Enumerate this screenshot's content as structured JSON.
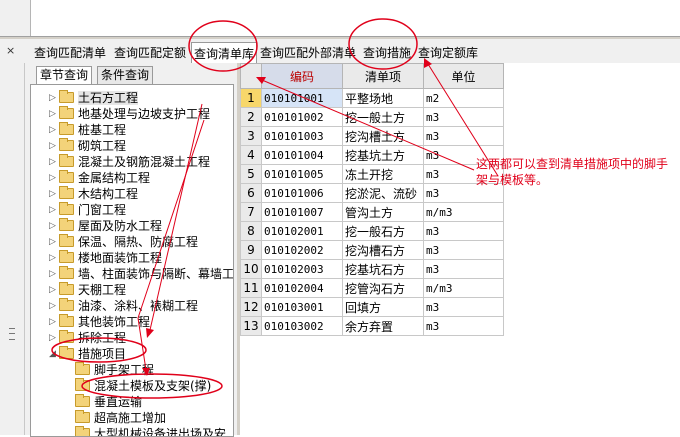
{
  "tabs": [
    {
      "label": "查询匹配清单",
      "active": false
    },
    {
      "label": "查询匹配定额",
      "active": false
    },
    {
      "label": "查询清单库",
      "active": true
    },
    {
      "label": "查询匹配外部清单",
      "active": false
    },
    {
      "label": "查询措施",
      "active": false
    },
    {
      "label": "查询定额库",
      "active": false
    }
  ],
  "close_button": "×",
  "subtabs": {
    "chapter": "章节查询",
    "condition": "条件查询"
  },
  "tree": [
    {
      "label": "土石方工程",
      "expander": "▷"
    },
    {
      "label": "地基处理与边坡支护工程",
      "expander": "▷"
    },
    {
      "label": "桩基工程",
      "expander": "▷"
    },
    {
      "label": "砌筑工程",
      "expander": "▷"
    },
    {
      "label": "混凝土及钢筋混凝土工程",
      "expander": "▷"
    },
    {
      "label": "金属结构工程",
      "expander": "▷"
    },
    {
      "label": "木结构工程",
      "expander": "▷"
    },
    {
      "label": "门窗工程",
      "expander": "▷"
    },
    {
      "label": "屋面及防水工程",
      "expander": "▷"
    },
    {
      "label": "保温、隔热、防腐工程",
      "expander": "▷"
    },
    {
      "label": "楼地面装饰工程",
      "expander": "▷"
    },
    {
      "label": "墙、柱面装饰与隔断、幕墙工",
      "expander": "▷"
    },
    {
      "label": "天棚工程",
      "expander": "▷"
    },
    {
      "label": "油漆、涂料、裱糊工程",
      "expander": "▷"
    },
    {
      "label": "其他装饰工程",
      "expander": "▷"
    },
    {
      "label": "拆除工程",
      "expander": "▷"
    },
    {
      "label": "措施项目",
      "expander": "◢"
    }
  ],
  "subtree": [
    {
      "label": "脚手架工程"
    },
    {
      "label": "混凝土模板及支架(撑)"
    },
    {
      "label": "垂直运输"
    },
    {
      "label": "超高施工增加"
    },
    {
      "label": "大型机械设备进出场及安"
    }
  ],
  "grid": {
    "headers": {
      "code": "编码",
      "item": "清单项",
      "unit": "单位"
    },
    "rows": [
      {
        "n": "1",
        "code": "010101001",
        "item": "平整场地",
        "unit": "m2"
      },
      {
        "n": "2",
        "code": "010101002",
        "item": "挖一般土方",
        "unit": "m3"
      },
      {
        "n": "3",
        "code": "010101003",
        "item": "挖沟槽土方",
        "unit": "m3"
      },
      {
        "n": "4",
        "code": "010101004",
        "item": "挖基坑土方",
        "unit": "m3"
      },
      {
        "n": "5",
        "code": "010101005",
        "item": "冻土开挖",
        "unit": "m3"
      },
      {
        "n": "6",
        "code": "010101006",
        "item": "挖淤泥、流砂",
        "unit": "m3"
      },
      {
        "n": "7",
        "code": "010101007",
        "item": "管沟土方",
        "unit": "m/m3"
      },
      {
        "n": "8",
        "code": "010102001",
        "item": "挖一般石方",
        "unit": "m3"
      },
      {
        "n": "9",
        "code": "010102002",
        "item": "挖沟槽石方",
        "unit": "m3"
      },
      {
        "n": "10",
        "code": "010102003",
        "item": "挖基坑石方",
        "unit": "m3"
      },
      {
        "n": "11",
        "code": "010102004",
        "item": "挖管沟石方",
        "unit": "m/m3"
      },
      {
        "n": "12",
        "code": "010103001",
        "item": "回填方",
        "unit": "m3"
      },
      {
        "n": "13",
        "code": "010103002",
        "item": "余方弃置",
        "unit": "m3"
      }
    ]
  },
  "annotation": "这两都可以查到清单措施项中的脚手架与模板等。",
  "colors": {
    "annotation": "#e0001a",
    "folder": "#f3d37a",
    "selected_row": "#f7d76a"
  }
}
